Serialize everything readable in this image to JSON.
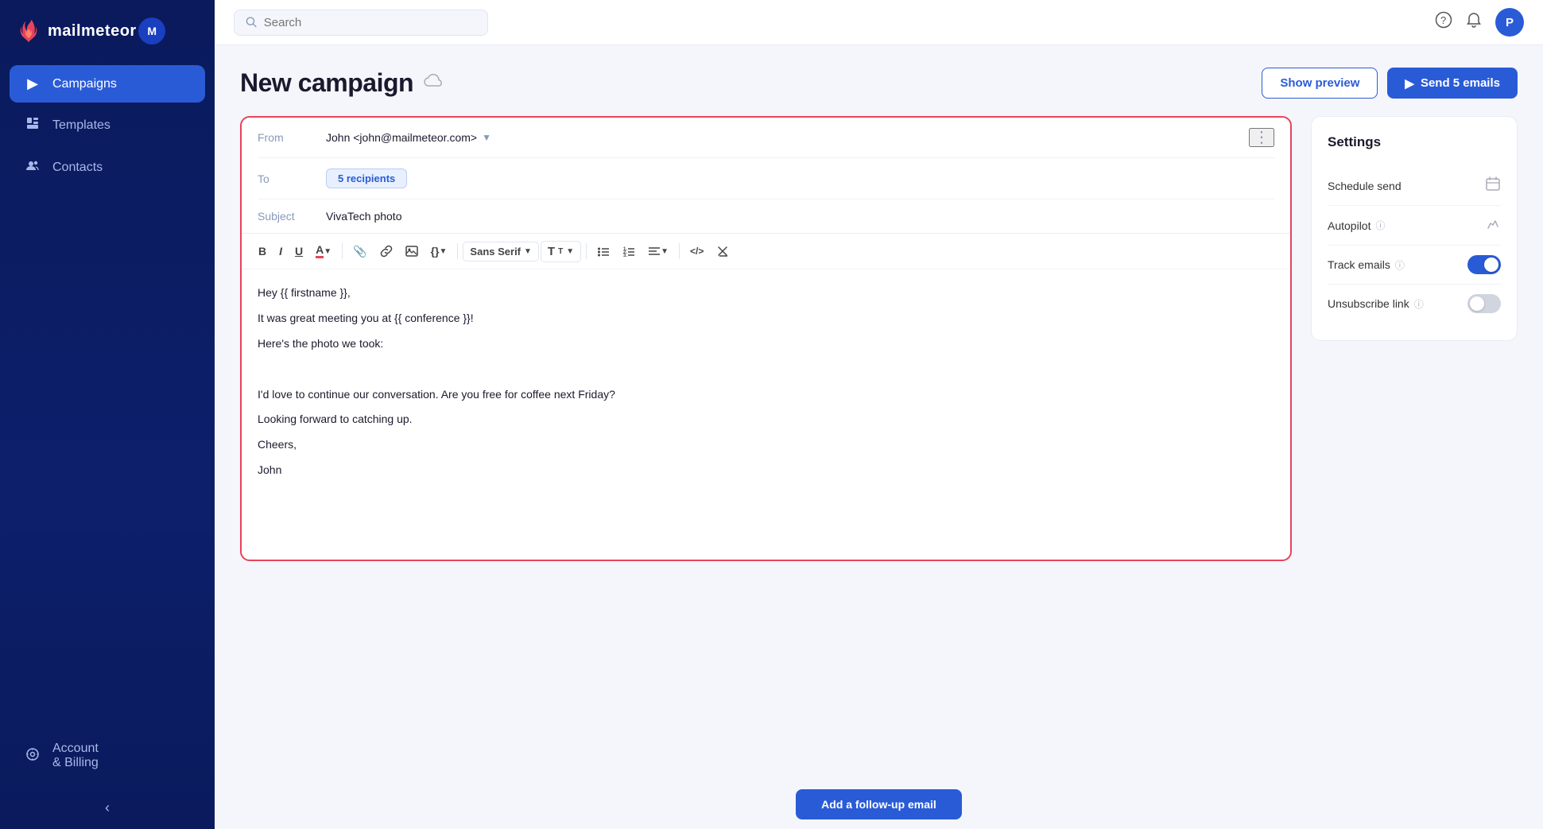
{
  "app": {
    "name": "mailmeteor",
    "logo_letter": "M"
  },
  "sidebar": {
    "items": [
      {
        "id": "campaigns",
        "label": "Campaigns",
        "icon": "▶",
        "active": true
      },
      {
        "id": "templates",
        "label": "Templates",
        "icon": "📄",
        "active": false
      },
      {
        "id": "contacts",
        "label": "Contacts",
        "icon": "👥",
        "active": false
      },
      {
        "id": "account-billing",
        "label": "Account\n& Billing",
        "icon": "⚙",
        "active": false
      }
    ],
    "collapse_icon": "‹"
  },
  "topbar": {
    "search_placeholder": "Search",
    "avatar_letter": "P"
  },
  "page": {
    "title": "New campaign",
    "cloud_icon": "☁"
  },
  "header_actions": {
    "preview_label": "Show preview",
    "send_label": "Send 5 emails",
    "send_icon": "▶"
  },
  "composer": {
    "from_label": "From",
    "from_value": "John <john@mailmeteor.com>",
    "to_label": "To",
    "to_value": "5 recipients",
    "subject_label": "Subject",
    "subject_value": "VivaTech photo",
    "more_icon": "⋮"
  },
  "toolbar": {
    "bold": "B",
    "italic": "I",
    "underline": "U",
    "color": "A",
    "attach": "📎",
    "link": "🔗",
    "image": "🖼",
    "code": "{}",
    "font": "Sans Serif",
    "font_size": "T",
    "bullet_list": "☰",
    "number_list": "☷",
    "align": "≡",
    "source": "</>",
    "clear": "✖"
  },
  "editor": {
    "lines": [
      "Hey {{ firstname }},",
      "",
      "It was great meeting you at {{ conference }}!",
      "",
      "Here's the photo we took:",
      "",
      "",
      "I'd love to continue our conversation. Are you free for coffee next Friday?",
      "",
      "Looking forward to catching up.",
      "",
      "Cheers,",
      "John"
    ]
  },
  "settings": {
    "title": "Settings",
    "items": [
      {
        "id": "schedule-send",
        "label": "Schedule send",
        "icon": "📅",
        "type": "icon",
        "info": false
      },
      {
        "id": "autopilot",
        "label": "Autopilot",
        "icon": "✏",
        "type": "icon",
        "info": true
      },
      {
        "id": "track-emails",
        "label": "Track emails",
        "icon": null,
        "type": "toggle",
        "value": true,
        "info": true
      },
      {
        "id": "unsubscribe-link",
        "label": "Unsubscribe link",
        "icon": null,
        "type": "toggle",
        "value": false,
        "info": true
      }
    ]
  },
  "footer": {
    "followup_label": "Add a follow-up email"
  }
}
